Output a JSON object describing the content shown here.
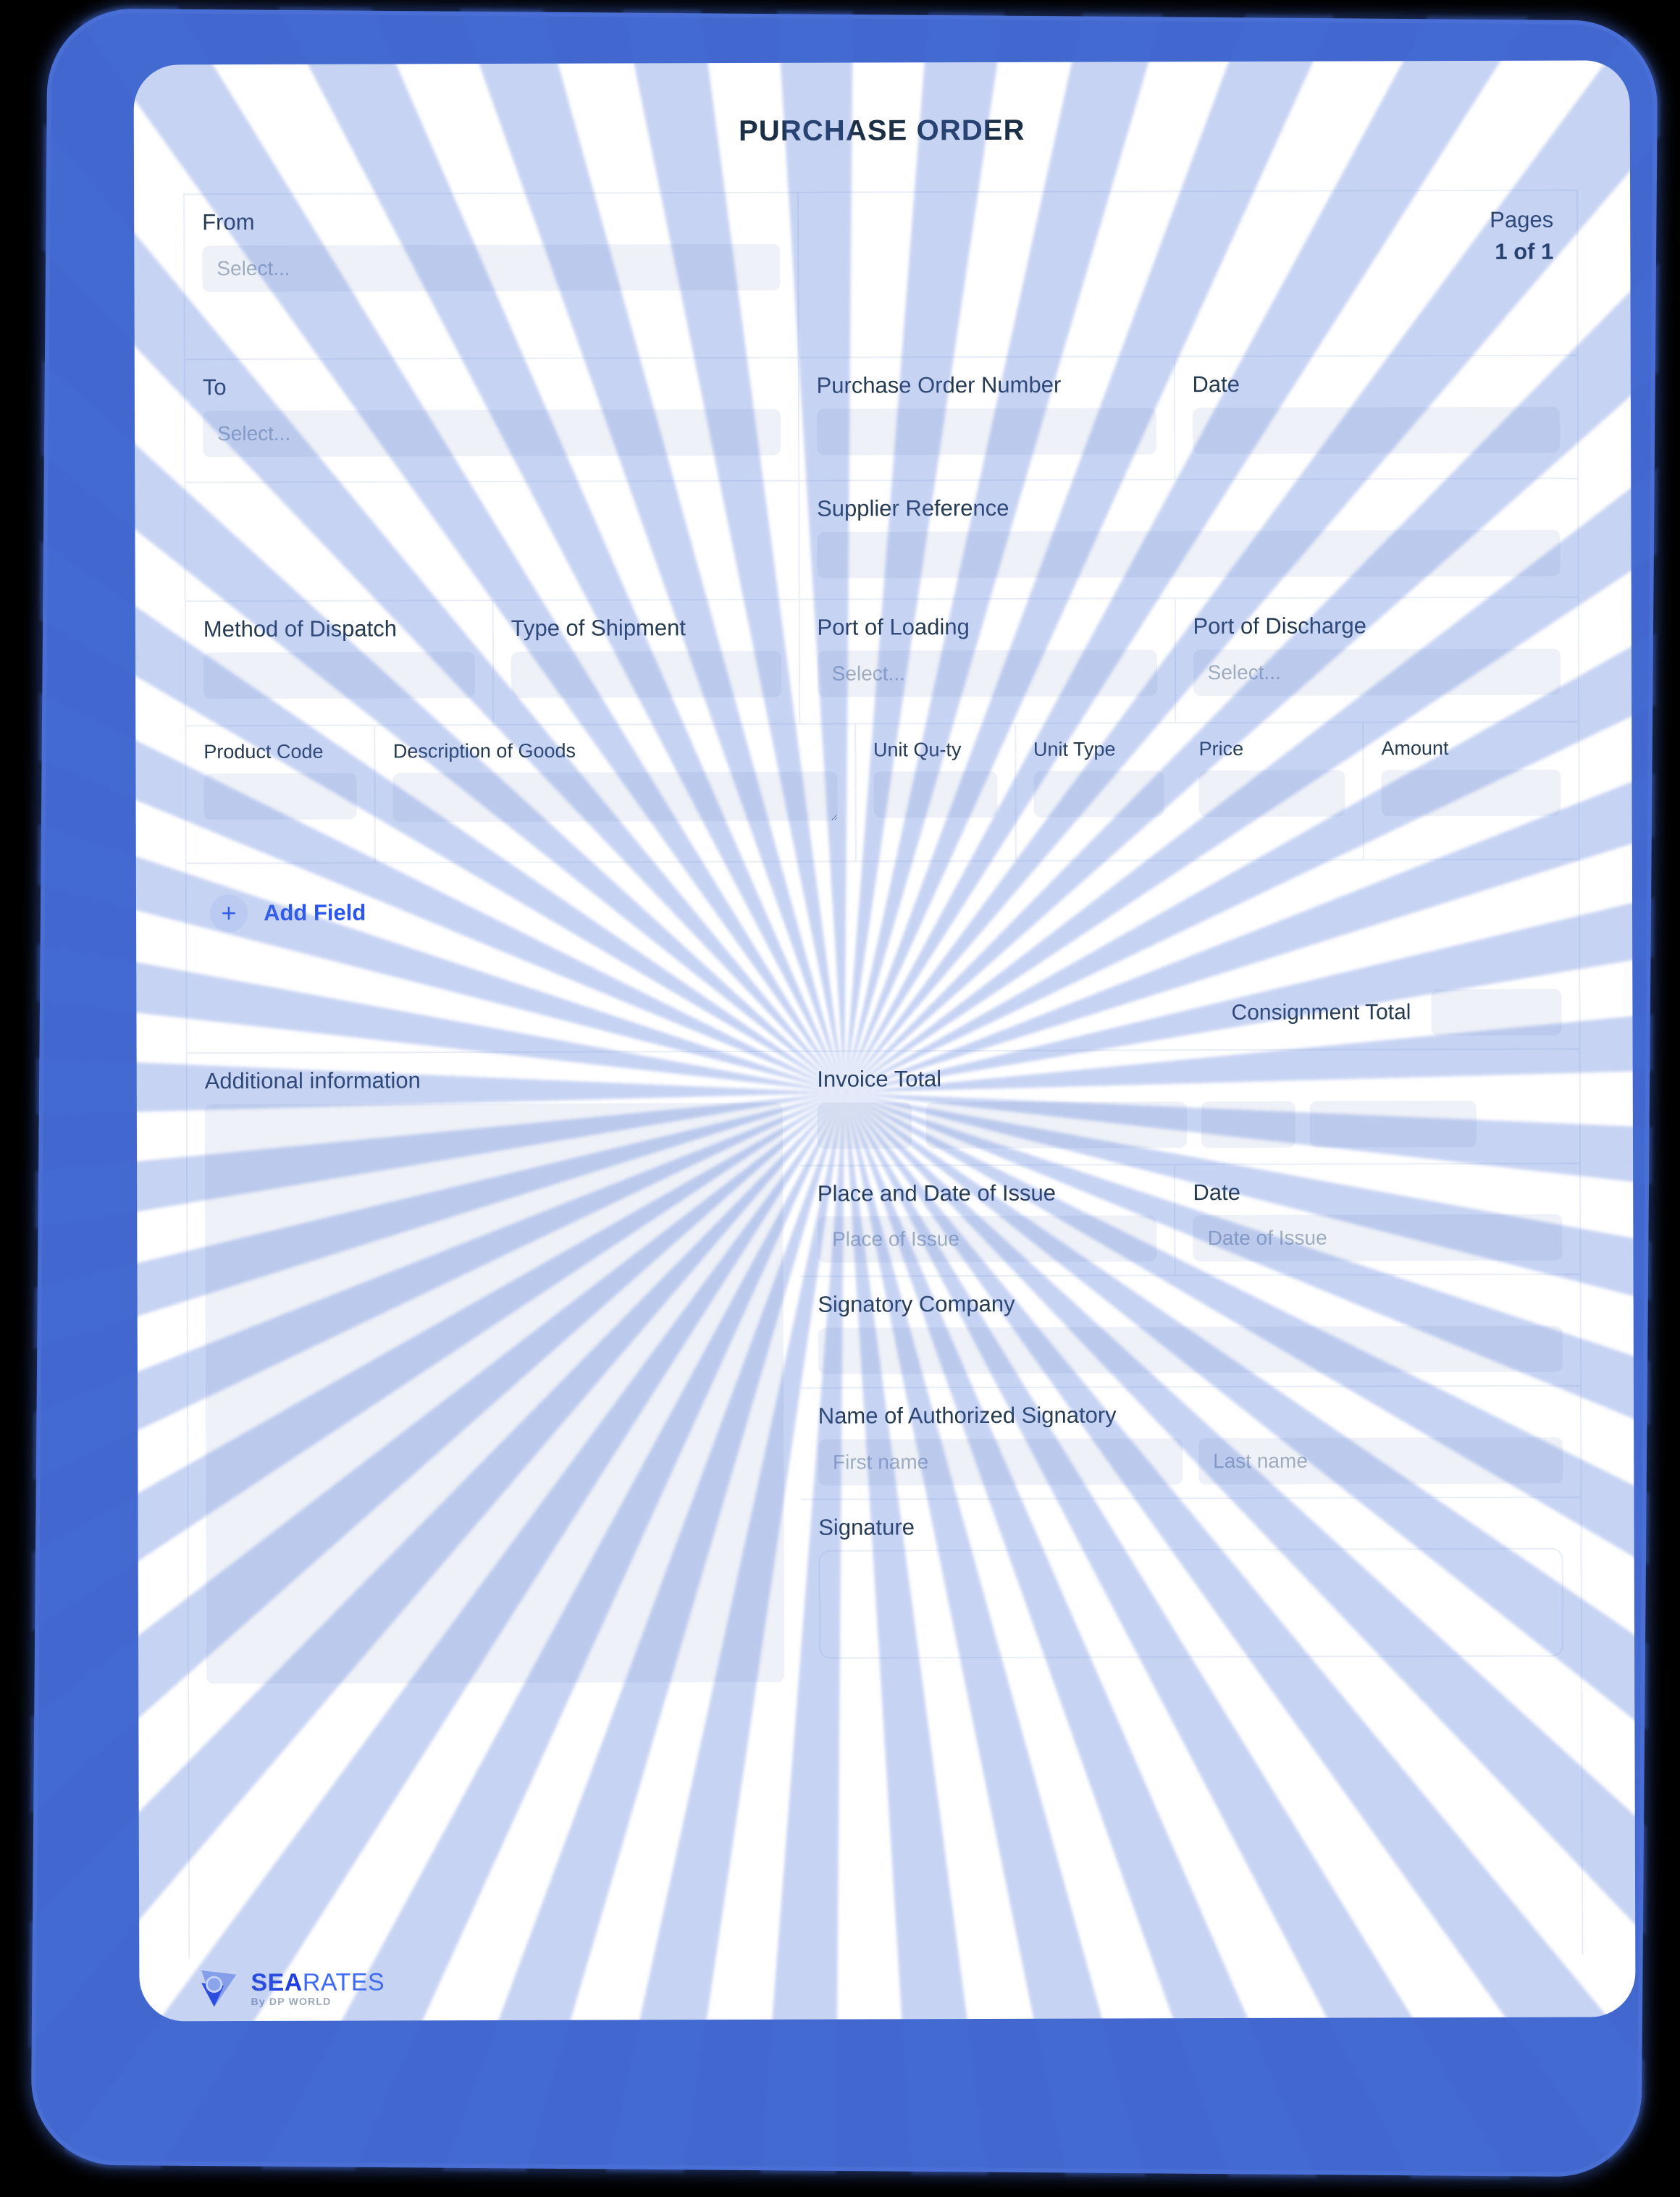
{
  "document": {
    "title": "PURCHASE ORDER",
    "pages_label": "Pages",
    "pages_value": "1 of 1"
  },
  "theme": {
    "frame_blue": "#4268cf",
    "accent_blue": "#2a56f0",
    "input_fill": "#eef1f7",
    "divider": "#e9eef6",
    "text_dark": "#1b2f45",
    "label": "#25394f",
    "placeholder": "#9fadbe"
  },
  "parties": {
    "from_label": "From",
    "from_placeholder": "Select...",
    "from_value": "",
    "to_label": "To",
    "to_placeholder": "Select...",
    "to_value": ""
  },
  "order": {
    "po_number_label": "Purchase Order Number",
    "po_number_value": "",
    "date_label": "Date",
    "date_value": "",
    "supplier_reference_label": "Supplier Reference",
    "supplier_reference_value": ""
  },
  "shipping": {
    "method_of_dispatch_label": "Method of Dispatch",
    "method_of_dispatch_value": "",
    "type_of_shipment_label": "Type of Shipment",
    "type_of_shipment_value": "",
    "port_of_loading_label": "Port of Loading",
    "port_of_loading_placeholder": "Select...",
    "port_of_loading_value": "",
    "port_of_discharge_label": "Port of Discharge",
    "port_of_discharge_placeholder": "Select...",
    "port_of_discharge_value": ""
  },
  "goods_table": {
    "columns": [
      "Product Code",
      "Description of Goods",
      "Unit Qu-ty",
      "Unit Type",
      "Price",
      "Amount"
    ],
    "rows": [
      {
        "product_code": "",
        "description": "",
        "unit_qty": "",
        "unit_type": "",
        "price": "",
        "amount": ""
      }
    ],
    "add_field_label": "Add Field",
    "add_field_icon": "plus-icon"
  },
  "totals": {
    "consignment_total_label": "Consignment Total",
    "consignment_total_value": "",
    "invoice_total_label": "Invoice Total",
    "invoice_total_values": [
      "",
      "",
      "",
      ""
    ]
  },
  "additional": {
    "label": "Additional information",
    "value": ""
  },
  "issue": {
    "place_label": "Place and Date of Issue",
    "place_placeholder": "Place of Issue",
    "place_value": "",
    "date_label": "Date",
    "date_placeholder": "Date of Issue",
    "date_value": ""
  },
  "signatory": {
    "company_label": "Signatory Company",
    "company_value": "",
    "name_label": "Name of Authorized Signatory",
    "first_name_placeholder": "First name",
    "first_name_value": "",
    "last_name_placeholder": "Last name",
    "last_name_value": "",
    "signature_label": "Signature",
    "signature_value": ""
  },
  "branding": {
    "logo_icon": "searates-logo-icon",
    "name_part1": "SEA",
    "name_part2": "RATES",
    "tagline": "By DP WORLD"
  }
}
